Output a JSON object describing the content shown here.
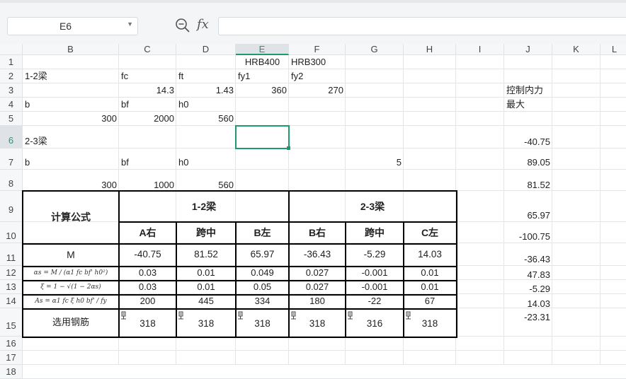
{
  "toolbar": {
    "name_box": "E6",
    "zoom_icon": "zoom-formula-icon",
    "fx_label": "fx",
    "formula_value": ""
  },
  "columns": [
    "B",
    "C",
    "D",
    "E",
    "F",
    "G",
    "H",
    "I",
    "J",
    "K",
    "L"
  ],
  "selected_column": "E",
  "rows": [
    "1",
    "2",
    "3",
    "4",
    "5",
    "6",
    "7",
    "8",
    "9",
    "10",
    "11",
    "12",
    "13",
    "14",
    "15",
    "16",
    "17",
    "18"
  ],
  "selected_row": "6",
  "sheet": {
    "e1": "HRB400",
    "f1": "HRB300",
    "b2": "1-2梁",
    "c2": "fc",
    "d2": "ft",
    "e2": "fy1",
    "f2": "fy2",
    "c3": "14.3",
    "d3": "1.43",
    "e3": "360",
    "f3": "270",
    "j3": "控制内力",
    "b4": "b",
    "c4": "bf",
    "d4": "h0",
    "j4": "最大",
    "b5": "300",
    "c5": "2000",
    "d5": "560",
    "b6": "2-3梁",
    "j6": "-40.75",
    "b7": "b",
    "c7": "bf",
    "d7": "h0",
    "g7": "5",
    "j7": "89.05",
    "b8": "300",
    "c8": "1000",
    "d8": "560",
    "j8": "81.52",
    "j9": "65.97",
    "j10": "-100.75",
    "j11": "-36.43",
    "j12": "47.83",
    "j13": "-5.29",
    "j14": "14.03",
    "j15": "-23.31"
  },
  "table": {
    "formula_header": "计算公式",
    "group1": "1-2梁",
    "group2": "2-3梁",
    "subheaders": [
      "A右",
      "跨中",
      "B左",
      "B右",
      "跨中",
      "C左"
    ],
    "row_m_label": "M",
    "row_m": [
      "-40.75",
      "81.52",
      "65.97",
      "-36.43",
      "-5.29",
      "14.03"
    ],
    "formula_alpha": "αs = M / (α1 fc bf' h0²)",
    "row_alpha": [
      "0.03",
      "0.01",
      "0.049",
      "0.027",
      "-0.001",
      "0.01"
    ],
    "formula_xi": "ξ = 1 − √(1 − 2αs)",
    "row_xi": [
      "0.03",
      "0.01",
      "0.05",
      "0.027",
      "-0.001",
      "0.01"
    ],
    "formula_as": "As = α1 fc ξ h0 bf' / fy",
    "row_as": [
      "200",
      "445",
      "334",
      "180",
      "-22",
      "67"
    ],
    "rebar_label": "选用钢筋",
    "row_rebar": [
      "318",
      "318",
      "318",
      "318",
      "316",
      "318"
    ]
  }
}
